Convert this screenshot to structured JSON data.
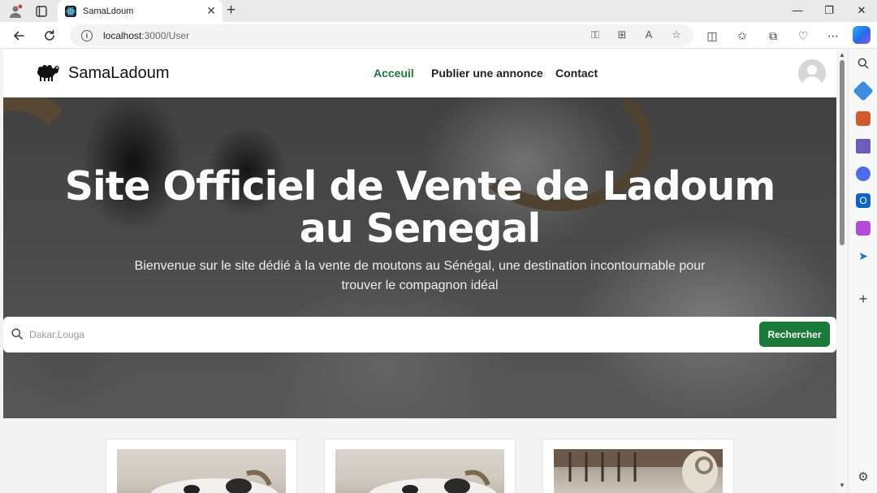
{
  "browser": {
    "tab_title": "SamaLdoum",
    "url_host": "localhost",
    "url_rest": ":3000/User"
  },
  "site": {
    "brand": "SamaLadoum",
    "nav": [
      "Acceuil",
      "Publier une annonce",
      "Contact"
    ],
    "active_nav": "Acceuil"
  },
  "hero": {
    "title": "Site Officiel de Vente de Ladoum au Senegal",
    "subtitle": "Bienvenue sur le site dédié à la vente de moutons au Sénégal, une destination incontournable pour trouver le compagnon idéal"
  },
  "search": {
    "placeholder": "Dakar,Louga",
    "button_label": "Rechercher"
  },
  "colors": {
    "accent_green": "#197a3a"
  },
  "icons": {
    "tabbar": [
      "profile-icon",
      "tab-actions-icon",
      "close-icon",
      "plus-icon",
      "minimize-icon",
      "restore-icon",
      "close-window-icon"
    ],
    "toolbar": [
      "back-icon",
      "refresh-icon",
      "info-icon",
      "key-icon",
      "apps-icon",
      "read-aloud-icon",
      "favorite-icon",
      "split-screen-icon",
      "favorites-icon",
      "collections-icon",
      "browser-essentials-icon",
      "more-icon",
      "copilot-icon"
    ],
    "sidebar": [
      "search-icon",
      "shopping-icon",
      "tools-icon",
      "games-icon",
      "microsoft365-icon",
      "outlook-icon",
      "designer-icon",
      "send-icon",
      "add-icon",
      "settings-icon"
    ]
  }
}
